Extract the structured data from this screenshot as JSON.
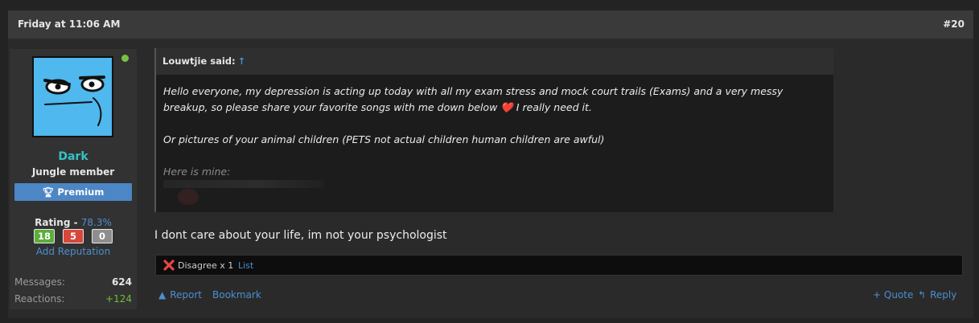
{
  "post": {
    "date": "Friday at 11:06 AM",
    "number": "#20"
  },
  "user": {
    "name": "Dark",
    "title": "Jungle member",
    "badge": "Premium",
    "rating_label": "Rating - ",
    "rating_pct": "78.3%",
    "rep_positive": "18",
    "rep_negative": "5",
    "rep_neutral": "0",
    "add_reputation": "Add Reputation",
    "messages_label": "Messages:",
    "messages_value": "624",
    "reactions_label": "Reactions:",
    "reactions_value": "+124"
  },
  "quote": {
    "author": "Louwtjie said:",
    "arrow": "↑",
    "p1": "Hello everyone, my depression is acting up today with all my exam stress and mock court trails (Exams) and a very messy breakup, so please share your favorite songs with me down below ❤️ I really need it.",
    "p2": "Or pictures of your animal children (PETS not actual children human children are awful)",
    "p3": "Here is mine:"
  },
  "message": "I dont care about your life, im not your psychologist",
  "reactions": {
    "text": "Disagree x 1",
    "list": "List"
  },
  "actions": {
    "report": "Report",
    "bookmark": "Bookmark",
    "quote": "+ Quote",
    "reply": "Reply"
  },
  "colors": {
    "accent": "#4c8ed0",
    "username": "#35c3c6",
    "premium": "#4c86c4",
    "rep_positive": "#5bae3b",
    "rep_negative": "#d9463a",
    "rep_neutral": "#8e8e8e",
    "online": "#7ac142"
  },
  "icons": {
    "badge": "trophy-icon",
    "reaction": "x-icon",
    "report": "warning-icon",
    "reply": "reply-arrow-icon"
  }
}
